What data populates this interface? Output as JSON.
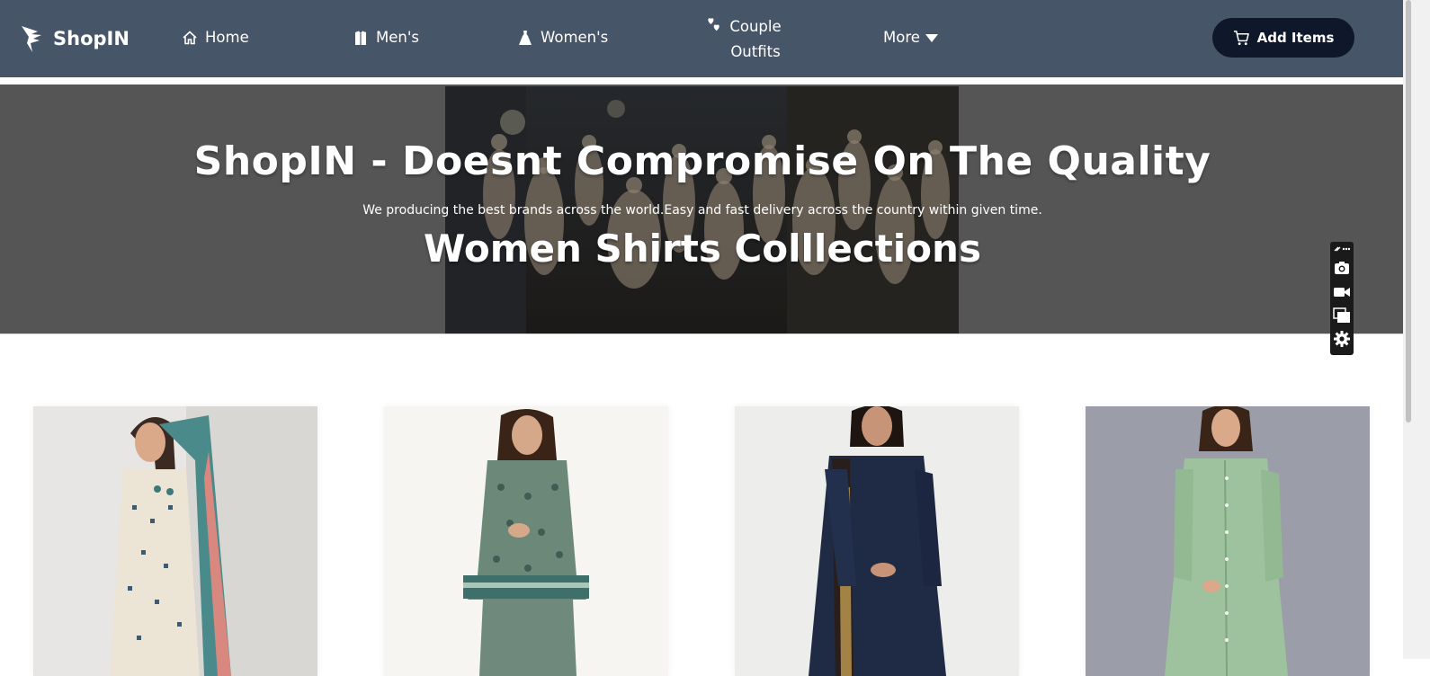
{
  "brand": {
    "name": "ShopIN",
    "logo_icon": "bird-logo-icon"
  },
  "nav": {
    "home": {
      "label": "Home",
      "icon": "home-icon"
    },
    "mens": {
      "label": "Men's",
      "icon": "shirt-icon"
    },
    "womens": {
      "label": "Women's",
      "icon": "dress-icon"
    },
    "couple": {
      "line1": "Couple",
      "line2": "Outfits",
      "icon": "hearts-icon"
    },
    "more": {
      "label": "More",
      "icon": "caret-down-icon"
    },
    "add_items": {
      "label": "Add Items",
      "icon": "cart-icon"
    }
  },
  "hero": {
    "title": "ShopIN - Doesnt Compromise On The Quality",
    "subtitle": "We producing the best brands across the world.Easy and fast delivery across the country within given time.",
    "collection": "Women Shirts Colllections"
  },
  "floating_toolbar": {
    "items": [
      "link-icon",
      "more-icon",
      "camera-icon",
      "video-icon",
      "copy-icon",
      "settings-icon"
    ]
  },
  "products": [
    {
      "image": "beige-embroidered-suit",
      "color": "#e8e2d6"
    },
    {
      "image": "green-printed-peplum-suit",
      "color": "#6f8a7c"
    },
    {
      "image": "navy-kurta-with-dupatta",
      "color": "#1f2a44"
    },
    {
      "image": "mint-green-shirt-dress",
      "color": "#9ec29e"
    }
  ],
  "colors": {
    "navbar": "#475569",
    "button": "#0f172a",
    "hero_overlay": "#555555"
  }
}
